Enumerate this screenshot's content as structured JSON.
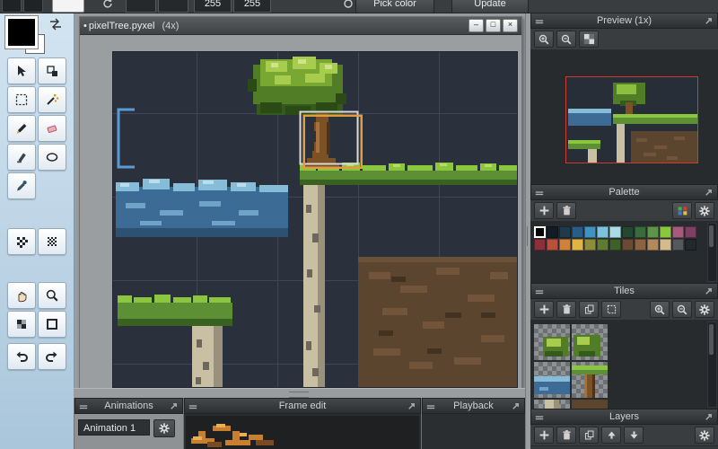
{
  "topbar": {
    "red_value": "255",
    "blue_value": "255",
    "pick_color_label": "Pick color",
    "update_label": "Update"
  },
  "window": {
    "dirty_marker": "•",
    "title": "pixelTree.pyxel",
    "zoom_label": "(4x)",
    "minimize_glyph": "–",
    "restore_glyph": "□",
    "close_glyph": "×"
  },
  "panels": {
    "preview": {
      "title": "Preview (1x)"
    },
    "palette": {
      "title": "Palette",
      "selected": {
        "row": 0,
        "index": 0
      },
      "rows": [
        [
          "#000000",
          "#131c24",
          "#1f3a4d",
          "#2a5d85",
          "#4092c0",
          "#7bc3dd",
          "#aadce8",
          "#23472f",
          "#3a6b3c",
          "#5d944a",
          "#8cc63f",
          "#a85a7d",
          "#7d3f63"
        ],
        [
          "#8c2f3b",
          "#b8503a",
          "#d0823c",
          "#e0b342",
          "#8c8c3a",
          "#5e7a33",
          "#3f6029",
          "#6b4a33",
          "#8c6340",
          "#b08a5a",
          "#d4ba8c",
          "#55595e",
          "#23282d"
        ]
      ]
    },
    "tiles": {
      "title": "Tiles"
    },
    "layers": {
      "title": "Layers"
    },
    "animations": {
      "title": "Animations",
      "current_animation": "Animation 1"
    },
    "frame_edit": {
      "title": "Frame edit"
    },
    "playback": {
      "title": "Playback"
    }
  },
  "scene_colors": {
    "canvas_bg": "#2a313c",
    "grid_line": "#3d4755",
    "leaf_light": "#a7cc4e",
    "leaf_mid": "#79a832",
    "leaf_dark": "#355a1d",
    "trunk_light": "#a8713a",
    "trunk_mid": "#7d5126",
    "trunk_dark": "#4e3117",
    "grass_light": "#8cc63f",
    "grass_mid": "#5d8f35",
    "grass_dark": "#39611f",
    "water_light": "#86bcd8",
    "water_mid": "#3c6b96",
    "water_dark": "#2c5173",
    "rock_light": "#c9c0a4",
    "rock_shade": "#99917a",
    "dirt_mid": "#5c452f",
    "dirt_light": "#71543a",
    "dirt_dark": "#433222",
    "tile_cursor_orange": "#e09c3f",
    "selection_blue": "#5b9bd5"
  }
}
